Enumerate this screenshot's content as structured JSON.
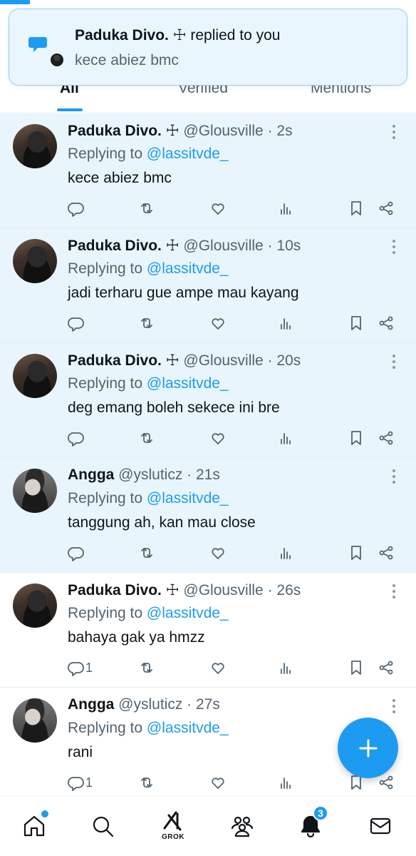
{
  "tabs": {
    "all": "All",
    "verified": "Verified",
    "mentions": "Mentions"
  },
  "toast": {
    "name": "Paduka Divo. ☩",
    "action": " replied to you",
    "message": "kece abiez bmc"
  },
  "replying_prefix": "Replying to ",
  "notifications": [
    {
      "name": "Paduka Divo. ☩",
      "handle": " @Glousville · 2s",
      "replying_to": "@lassitvde_",
      "text": "kece abiez bmc",
      "replies": "",
      "unread": true,
      "avatar": "paduka"
    },
    {
      "name": "Paduka Divo. ☩",
      "handle": " @Glousville · 10s",
      "replying_to": "@lassitvde_",
      "text": "jadi terharu gue ampe mau kayang",
      "replies": "",
      "unread": true,
      "avatar": "paduka"
    },
    {
      "name": "Paduka Divo. ☩",
      "handle": " @Glousville · 20s",
      "replying_to": "@lassitvde_",
      "text": "deg emang boleh sekece ini bre",
      "replies": "",
      "unread": true,
      "avatar": "paduka"
    },
    {
      "name": "Angga",
      "handle": " @ysluticz · 21s",
      "replying_to": "@lassitvde_",
      "text": "tanggung ah, kan mau close",
      "replies": "",
      "unread": true,
      "avatar": "angga"
    },
    {
      "name": "Paduka Divo. ☩",
      "handle": " @Glousville · 26s",
      "replying_to": "@lassitvde_",
      "text": "bahaya gak ya hmzz",
      "replies": "1",
      "unread": false,
      "avatar": "paduka"
    },
    {
      "name": "Angga",
      "handle": " @ysluticz · 27s",
      "replying_to": "@lassitvde_",
      "text": "rani",
      "replies": "1",
      "unread": false,
      "avatar": "angga"
    }
  ],
  "bottom_nav": {
    "grok_label": "GROK",
    "notification_count": "3"
  },
  "colors": {
    "accent": "#1d9bf0",
    "unread_bg": "#e8f5fd",
    "secondary_text": "#536471"
  },
  "icons": [
    "reply-icon",
    "retweet-icon",
    "like-icon",
    "views-icon",
    "bookmark-icon",
    "share-icon",
    "more-icon",
    "home-icon",
    "search-icon",
    "grok-icon",
    "communities-icon",
    "bell-icon",
    "mail-icon",
    "plus-icon",
    "chat-bubble-icon"
  ]
}
